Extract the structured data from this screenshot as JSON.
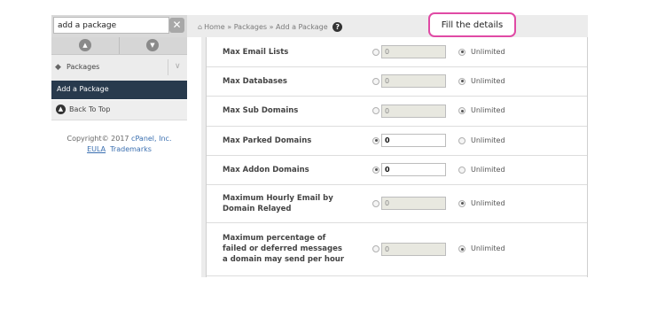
{
  "sidebar": {
    "search_value": "add a package",
    "clear_glyph": "✕",
    "packages_label": "Packages",
    "add_package_label": "Add a Package",
    "back_to_top_label": "Back To Top",
    "copyright_prefix": "Copyright© 2017",
    "copyright_company": "cPanel, Inc.",
    "eula_link": "EULA",
    "trademarks_link": "Trademarks"
  },
  "breadcrumb": {
    "home": "Home",
    "packages": "Packages",
    "current": "Add a Package",
    "separator": "»",
    "help_glyph": "?"
  },
  "callout": {
    "text": "Fill the details"
  },
  "form": {
    "rows": [
      {
        "label": "Max Email Lists",
        "value": "0",
        "selected": "unlimited",
        "unlimited_label": "Unlimited"
      },
      {
        "label": "Max Databases",
        "value": "0",
        "selected": "unlimited",
        "unlimited_label": "Unlimited"
      },
      {
        "label": "Max Sub Domains",
        "value": "0",
        "selected": "unlimited",
        "unlimited_label": "Unlimited"
      },
      {
        "label": "Max Parked Domains",
        "value": "0",
        "selected": "value",
        "unlimited_label": "Unlimited"
      },
      {
        "label": "Max Addon Domains",
        "value": "0",
        "selected": "value",
        "unlimited_label": "Unlimited"
      },
      {
        "label_lines": [
          "Maximum Hourly Email by",
          "Domain Relayed"
        ],
        "value": "0",
        "selected": "unlimited",
        "unlimited_label": "Unlimited"
      },
      {
        "label_lines": [
          "Maximum percentage of",
          "failed or deferred messages",
          "a domain may send per hour"
        ],
        "value": "0",
        "selected": "unlimited",
        "unlimited_label": "Unlimited"
      }
    ]
  }
}
